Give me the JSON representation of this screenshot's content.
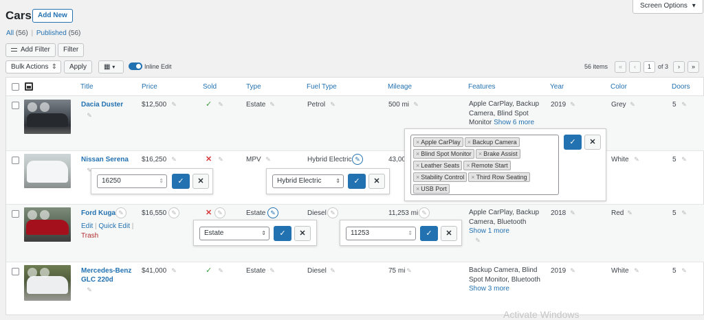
{
  "page": {
    "title": "Cars",
    "add_new": "Add New",
    "screen_options": "Screen Options"
  },
  "views": {
    "all_label": "All",
    "all_count": "(56)",
    "separator": "|",
    "published_label": "Published",
    "published_count": "(56)"
  },
  "toolbar": {
    "add_filter": "Add Filter",
    "filter": "Filter",
    "bulk_actions": "Bulk Actions",
    "apply": "Apply",
    "inline_edit": "Inline Edit",
    "items_count": "56 items",
    "current_page": "1",
    "total_pages": "of 3",
    "first_page": "«",
    "prev_page": "‹",
    "next_page": "›",
    "last_page": "»"
  },
  "columns": [
    "Title",
    "Price",
    "Sold",
    "Type",
    "Fuel Type",
    "Mileage",
    "Features",
    "Year",
    "Color",
    "Doors"
  ],
  "rows": [
    {
      "title": "Dacia Duster",
      "price": "$12,500",
      "sold": "✓",
      "type": "Estate",
      "fuel": "Petrol",
      "mileage": "500 mi",
      "features": "Apple CarPlay, Backup Camera, Blind Spot Monitor",
      "features_more": "Show 6 more",
      "year": "2019",
      "color": "Grey",
      "doors": "5"
    },
    {
      "title": "Nissan Serena",
      "price": "$16,250",
      "sold": "✕",
      "type": "MPV",
      "fuel": "Hybrid Electric",
      "mileage": "43,00",
      "year": "",
      "color": "White",
      "doors": "5"
    },
    {
      "title": "Ford Kuga",
      "price": "$16,550",
      "sold": "✕",
      "type": "Estate",
      "fuel": "Diesel",
      "mileage": "11,253 mi",
      "features": "Apple CarPlay, Backup Camera, Bluetooth",
      "features_more": "Show 1 more",
      "year": "2018",
      "color": "Red",
      "doors": "5",
      "actions": {
        "edit": "Edit",
        "quick_edit": "Quick Edit",
        "sep": "|",
        "trash": "Trash"
      }
    },
    {
      "title": "Mercedes-Benz GLC 220d",
      "price": "$41,000",
      "sold": "✓",
      "type": "Estate",
      "fuel": "Diesel",
      "mileage": "75 mi",
      "features": "Backup Camera, Blind Spot Monitor, Bluetooth",
      "features_more": "Show 3 more",
      "year": "2019",
      "color": "White",
      "doors": "5"
    }
  ],
  "editors": {
    "price_value": "16250",
    "fuel_selected": "Hybrid Electric",
    "type_selected": "Estate",
    "mileage_value": "11253",
    "feature_tags": [
      "Apple CarPlay",
      "Backup Camera",
      "Blind Spot Monitor",
      "Brake Assist",
      "Leather Seats",
      "Remote Start",
      "Stability Control",
      "Third Row Seating",
      "USB Port"
    ],
    "tag_remove": "×",
    "confirm": "✓",
    "cancel": "✕"
  },
  "watermark": "Activate Windows",
  "colors": {
    "accent": "#2271b1",
    "check": "#3a9a3a",
    "cross": "#d63638",
    "trash": "#b32d2e"
  },
  "icons": {
    "pencil": "✎",
    "dropdown": "▾",
    "updown": "⇕",
    "grid": "▦"
  }
}
